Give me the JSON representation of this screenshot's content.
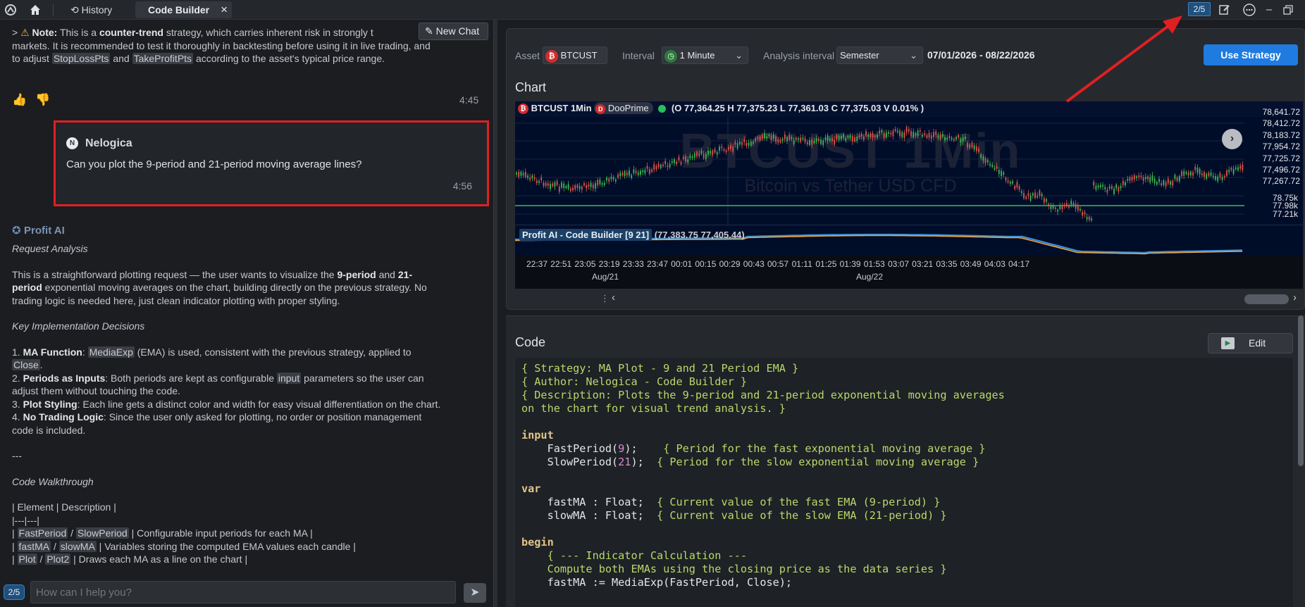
{
  "topbar": {
    "history_label": "History",
    "tab_label": "Code Builder",
    "tab_close": "×",
    "page_badge": "2/5"
  },
  "chat": {
    "new_chat_label": "New Chat",
    "note": {
      "prefix": ">",
      "label": "Note:",
      "t1": " This is a ",
      "bold1": "counter-trend",
      "t2": " strategy, which carries inherent risk in strongly t",
      "line2": "markets. It is recommended to test it thoroughly in backtesting before using it in live trading, and",
      "line3a": "to adjust ",
      "chip1": "StopLossPts",
      "line3b": " and ",
      "chip2": "TakeProfitPts",
      "line3c": " according to the asset's typical price range."
    },
    "ai_msg_time": "4:45",
    "user_msg": {
      "avatar": "N",
      "name": "Nelogica",
      "text": "Can you plot the 9-period and 21-period moving average lines?",
      "time": "4:56"
    },
    "response": {
      "sender": "Profit AI",
      "request_heading": "Request Analysis",
      "p1a": "This is a straightforward plotting request — the user wants to visualize the ",
      "p1b": "9-period",
      "p1c": " and ",
      "p1d": "21-",
      "p1e": "period",
      "p1f": " exponential moving averages on the chart, building directly on the previous strategy. No",
      "p1g": "trading logic is needed here, just clean indicator plotting with proper styling.",
      "decisions_heading": "Key Implementation Decisions",
      "d1a": "1. ",
      "d1b": "MA Function",
      "d1c": ": ",
      "d1chip": "MediaExp",
      "d1d": " (EMA) is used, consistent with the previous strategy, applied to",
      "d1chip2": "Close",
      "d1e": ".",
      "d2a": "2. ",
      "d2b": "Periods as Inputs",
      "d2c": ": Both periods are kept as configurable ",
      "d2chip": "input",
      "d2d": " parameters so the user can",
      "d2e": "adjust them without touching the code.",
      "d3a": "3. ",
      "d3b": "Plot Styling",
      "d3c": ": Each line gets a distinct color and width for easy visual differentiation on the chart.",
      "d4a": "4. ",
      "d4b": "No Trading Logic",
      "d4c": ": Since the user only asked for plotting, no order or position management",
      "d4d": "code is included.",
      "rule": "---",
      "walk_heading": "Code Walkthrough",
      "t_header": "| Element | Description |",
      "t_sep": "|---|---|",
      "r1a": "| ",
      "r1c1": "FastPeriod",
      "r1s": " / ",
      "r1c2": "SlowPeriod",
      "r1b": " | Configurable input periods for each MA |",
      "r2c1": "fastMA",
      "r2c2": "slowMA",
      "r2b": " | Variables storing the computed EMA values each candle |",
      "r3c1": "Plot",
      "r3c2": "Plot2",
      "r3b": " | Draws each MA as a line on the chart |"
    },
    "input_placeholder": "How can I help you?",
    "input_badge": "2/5"
  },
  "settings": {
    "asset_label": "Asset",
    "asset_value": "BTCUST",
    "interval_label": "Interval",
    "interval_value": "1 Minute",
    "analysis_label": "Analysis interval",
    "analysis_value": "Semester",
    "date_range": "07/01/2026 - 08/22/2026",
    "use_strategy_label": "Use Strategy"
  },
  "chart_section_title": "Chart",
  "chart": {
    "symbol": "BTCUST 1Min",
    "broker": "DooPrime",
    "ohlc": "(O 77,364.25 H 77,375.23 L 77,361.03 C 77,375.03 V 0.01% )",
    "watermark_title": "BTCUST 1Min",
    "watermark_subtitle": "Bitcoin vs Tether USD CFD",
    "indicator_label": "Profit AI - Code Builder [9 21]",
    "indicator_values": "(77,383.75 77,405.44)",
    "price_ticks": [
      "78,641.72",
      "78,412.72",
      "78,183.72",
      "77,954.72",
      "77,725.72",
      "77,496.72",
      "77,267.72"
    ],
    "indicator_ticks": [
      "78.75k",
      "77.98k",
      "77.21k"
    ],
    "time_ticks": [
      "22:37",
      "22:51",
      "23:05",
      "23:19",
      "23:33",
      "23:47",
      "00:01",
      "00:15",
      "00:29",
      "00:43",
      "00:57",
      "01:11",
      "01:25",
      "01:39",
      "01:53",
      "03:07",
      "03:21",
      "03:35",
      "03:49",
      "04:03",
      "04:17"
    ],
    "date_ticks": [
      "Aug/21",
      "Aug/22"
    ],
    "colors": {
      "up": "#3fb950",
      "down": "#e5534b",
      "fast_ema": "#e8a33d",
      "slow_ema": "#3a8fd9",
      "ref_line": "#2f8f4f"
    }
  },
  "code_section_title": "Code",
  "edit_label": "Edit",
  "code_lines": [
    "{ Strategy: MA Plot - 9 and 21 Period EMA }",
    "{ Author: Nelogica - Code Builder }",
    "{ Description: Plots the 9-period and 21-period exponential moving averages",
    "on the chart for visual trend analysis. }",
    "",
    "input",
    "    FastPeriod(9);    { Period for the fast exponential moving average }",
    "    SlowPeriod(21);  { Period for the slow exponential moving average }",
    "",
    "var",
    "    fastMA : Float;  { Current value of the fast EMA (9-period) }",
    "    slowMA : Float;  { Current value of the slow EMA (21-period) }",
    "",
    "begin",
    "    { --- Indicator Calculation ---",
    "    Compute both EMAs using the closing price as the data series }",
    "    fastMA := MediaExp(FastPeriod, Close);"
  ]
}
